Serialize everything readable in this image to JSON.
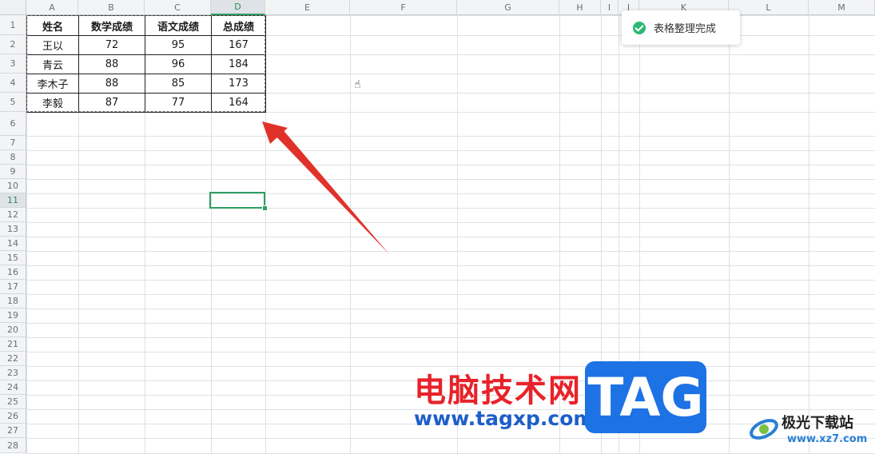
{
  "columns": [
    "A",
    "B",
    "C",
    "D",
    "E",
    "F",
    "G",
    "H",
    "I",
    "J",
    "K",
    "L",
    "M"
  ],
  "rows": [
    "1",
    "2",
    "3",
    "4",
    "5",
    "6",
    "7",
    "8",
    "9",
    "10",
    "11",
    "12",
    "13",
    "14",
    "15",
    "16",
    "17",
    "18",
    "19",
    "20",
    "21",
    "22",
    "23",
    "24",
    "25",
    "26",
    "27",
    "28"
  ],
  "active_column": "D",
  "active_row": "11",
  "table": {
    "headers": [
      "姓名",
      "数学成绩",
      "语文成绩",
      "总成绩"
    ],
    "rows": [
      [
        "王以",
        "72",
        "95",
        "167"
      ],
      [
        "青云",
        "88",
        "96",
        "184"
      ],
      [
        "李木子",
        "88",
        "85",
        "173"
      ],
      [
        "李毅",
        "87",
        "77",
        "164"
      ]
    ]
  },
  "toast": {
    "text": "表格整理完成",
    "icon": "check-circle-icon"
  },
  "arrow_color": "#e0322a",
  "watermark": {
    "brand_cn": "电脑技术网",
    "brand_tag": "TAG",
    "brand_url": "www.tagxp.com",
    "site2_cn": "极光下载站",
    "site2_url": "www.xz7.com"
  }
}
